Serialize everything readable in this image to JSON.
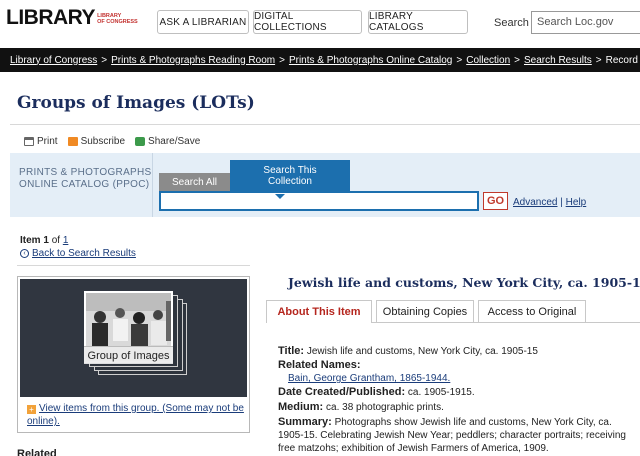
{
  "header": {
    "logo_main": "LIBRARY",
    "logo_sub_line1": "LIBRARY",
    "logo_sub_line2": "OF CONGRESS",
    "buttons": [
      "ASK A LIBRARIAN",
      "DIGITAL COLLECTIONS",
      "LIBRARY CATALOGS"
    ],
    "search_label": "Search",
    "search_placeholder": "Search Loc.gov"
  },
  "breadcrumb": {
    "items": [
      "Library of Congress",
      "Prints & Photographs Reading Room",
      "Prints & Photographs Online Catalog",
      "Collection",
      "Search Results"
    ],
    "separator": ">",
    "current": "Record"
  },
  "page_title": "Groups of Images (LOTs)",
  "tools": {
    "print": "Print",
    "subscribe": "Subscribe",
    "share": "Share/Save"
  },
  "ppoc": {
    "label_line1": "PRINTS & PHOTOGRAPHS",
    "label_line2": "ONLINE CATALOG (PPOC)",
    "tab_all": "Search All",
    "tab_collection_line1": "Search This",
    "tab_collection_line2": "Collection",
    "go": "GO",
    "advanced": "Advanced",
    "sep": "|",
    "help": "Help"
  },
  "results": {
    "item_word": "Item",
    "item_num": "1",
    "of_word": "of",
    "total": "1",
    "back": "Back to Search Results"
  },
  "image_panel": {
    "group_label": "Group of Images",
    "view_link": "View items from this group. (Some may not be online)."
  },
  "related_cut": "Related",
  "record": {
    "title": "Jewish life and customs, New York City, ca. 1905-15",
    "tabs": [
      "About This Item",
      "Obtaining Copies",
      "Access to Original"
    ],
    "fields": {
      "title_label": "Title:",
      "title_value": "Jewish life and customs, New York City, ca. 1905-15",
      "related_label": "Related Names:",
      "related_value": "Bain, George Grantham, 1865-1944.",
      "date_label": "Date Created/Published:",
      "date_value": "ca. 1905-1915.",
      "medium_label": "Medium:",
      "medium_value": "ca. 38 photographic prints.",
      "summary_label": "Summary:",
      "summary_value": "Photographs show Jewish life and customs, New York City, ca. 1905-15. Celebrating Jewish New Year; peddlers; character portraits; receiving free matzohs; exhibition of Jewish Farmers of America, 1909."
    }
  },
  "colors": {
    "title_navy": "#1b2d5d",
    "accent_blue": "#1c6fae",
    "active_tab_red": "#b5261e",
    "panel_bg": "#e4eef7"
  }
}
